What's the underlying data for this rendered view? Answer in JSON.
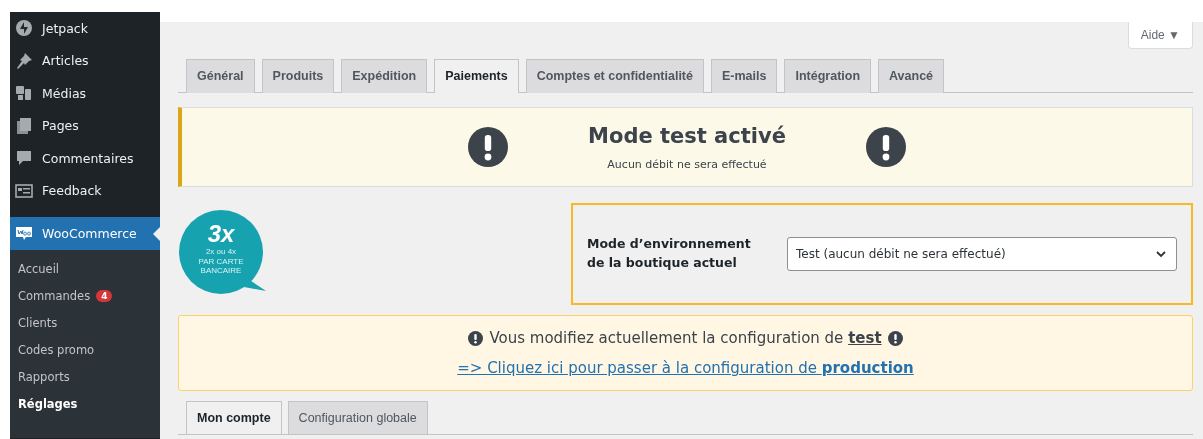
{
  "sidebar": {
    "items": [
      {
        "label": "Jetpack",
        "selected": false
      },
      {
        "label": "Articles",
        "selected": false
      },
      {
        "label": "Médias",
        "selected": false
      },
      {
        "label": "Pages",
        "selected": false
      },
      {
        "label": "Commentaires",
        "selected": false
      },
      {
        "label": "Feedback",
        "selected": false
      },
      {
        "label": "WooCommerce",
        "selected": true
      }
    ],
    "submenu": [
      {
        "label": "Accueil",
        "selected": false
      },
      {
        "label": "Commandes",
        "selected": false,
        "badge": "4"
      },
      {
        "label": "Clients",
        "selected": false
      },
      {
        "label": "Codes promo",
        "selected": false
      },
      {
        "label": "Rapports",
        "selected": false
      },
      {
        "label": "Réglages",
        "selected": true
      }
    ]
  },
  "help_button": "Aide ▼",
  "tabs": [
    {
      "label": "Général",
      "selected": false
    },
    {
      "label": "Produits",
      "selected": false
    },
    {
      "label": "Expédition",
      "selected": false
    },
    {
      "label": "Paiements",
      "selected": true
    },
    {
      "label": "Comptes et confidentialité",
      "selected": false
    },
    {
      "label": "E-mails",
      "selected": false
    },
    {
      "label": "Intégration",
      "selected": false
    },
    {
      "label": "Avancé",
      "selected": false
    }
  ],
  "test_notice": {
    "title": "Mode test activé",
    "subtitle": "Aucun débit ne sera effectué"
  },
  "logo": {
    "big": "3x",
    "small": "2x ou 4x",
    "caption_1": "PAR CARTE",
    "caption_2": "BANCAIRE"
  },
  "environment": {
    "label": "Mode d’environnement de la boutique actuel",
    "value": "Test (aucun débit ne sera effectué)"
  },
  "config_notice": {
    "text": "Vous modifiez actuellement la configuration de **test**",
    "link": "=> Cliquez ici pour passer à la configuration de **production**"
  },
  "subtabs": [
    {
      "label": "Mon compte",
      "selected": true
    },
    {
      "label": "Configuration globale",
      "selected": false
    }
  ]
}
